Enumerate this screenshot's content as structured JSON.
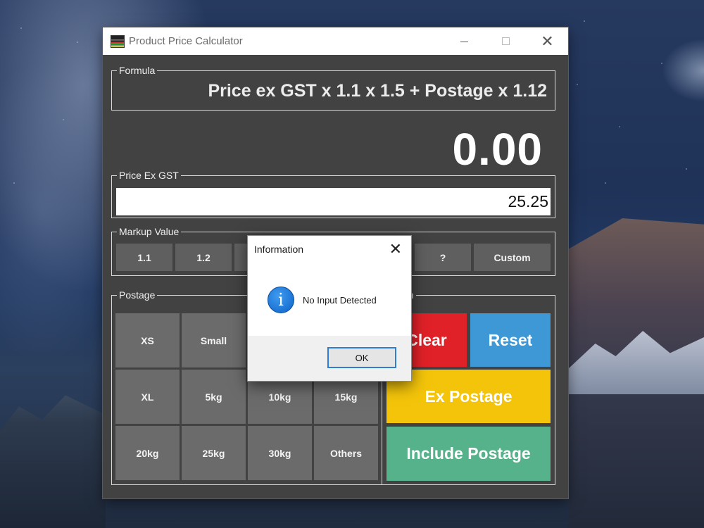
{
  "window": {
    "title": "Product Price Calculator"
  },
  "formula": {
    "label": "Formula",
    "text": "Price ex GST x 1.1 x 1.5 + Postage x 1.12"
  },
  "result": "0.00",
  "price_ex_gst": {
    "label": "Price Ex GST",
    "value": "25.25"
  },
  "markup": {
    "label": "Markup Value",
    "buttons": [
      "1.1",
      "1.2",
      "?",
      "Custom"
    ]
  },
  "postage": {
    "label": "Postage",
    "buttons": [
      "XS",
      "Small",
      "XL",
      "5kg",
      "10kg",
      "15kg",
      "20kg",
      "25kg",
      "30kg",
      "Others"
    ]
  },
  "action": {
    "label_visible": "on",
    "clear": "Clear",
    "reset": "Reset",
    "ex_postage": "Ex Postage",
    "include_postage": "Include Postage",
    "colors": {
      "clear": "#e02127",
      "reset": "#3f98d6",
      "ex_postage": "#f3c40a",
      "include_postage": "#56b28a"
    }
  },
  "dialog": {
    "title": "Information",
    "message": "No Input Detected",
    "ok": "OK",
    "icon": "info-icon"
  }
}
